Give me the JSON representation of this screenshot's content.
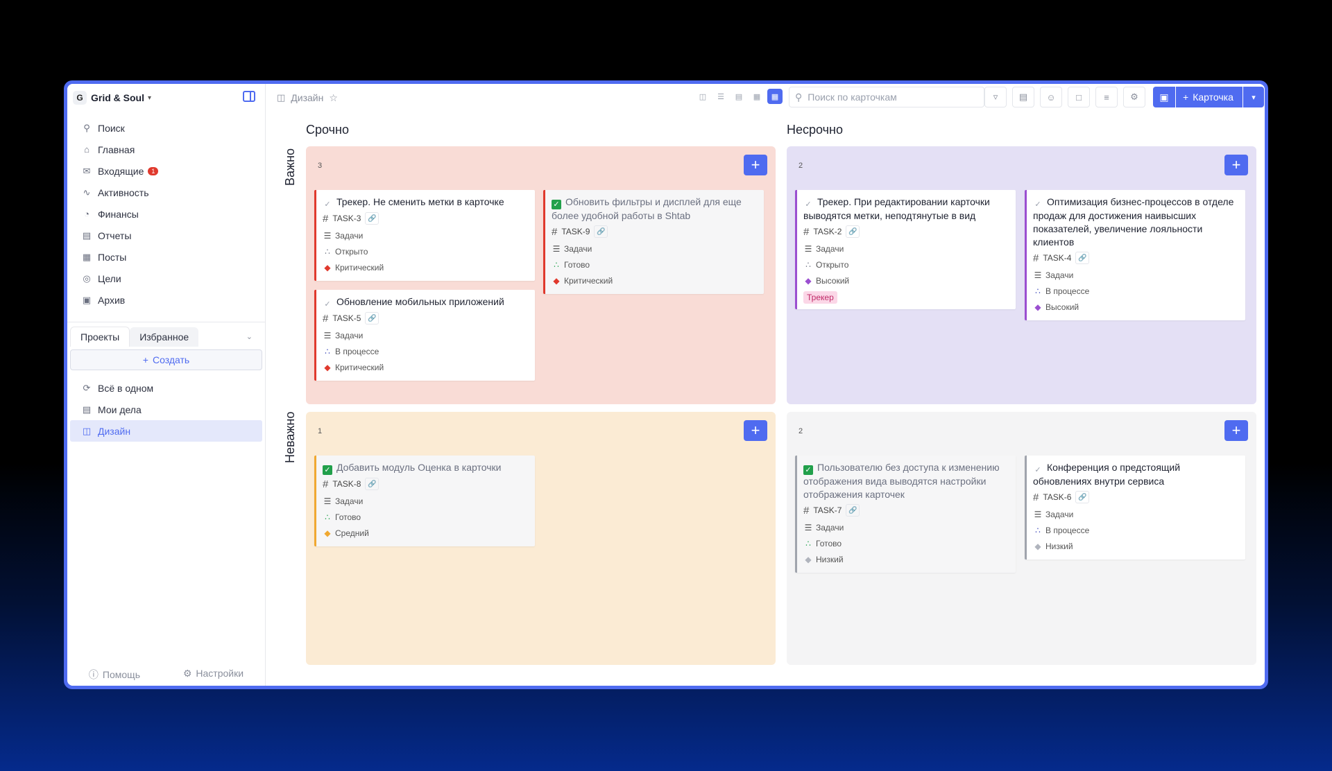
{
  "workspace": {
    "initial": "G",
    "name": "Grid & Soul"
  },
  "nav": [
    {
      "label": "Поиск",
      "icon": "search-icon"
    },
    {
      "label": "Главная",
      "icon": "home-icon"
    },
    {
      "label": "Входящие",
      "icon": "inbox-icon",
      "badge": "1"
    },
    {
      "label": "Активность",
      "icon": "activity-icon"
    },
    {
      "label": "Финансы",
      "icon": "finance-icon"
    },
    {
      "label": "Отчеты",
      "icon": "report-icon"
    },
    {
      "label": "Посты",
      "icon": "posts-icon"
    },
    {
      "label": "Цели",
      "icon": "goals-icon"
    },
    {
      "label": "Архив",
      "icon": "archive-icon"
    }
  ],
  "tabs": {
    "projects": "Проекты",
    "favorites": "Избранное"
  },
  "create_label": "Создать",
  "projects": [
    {
      "label": "Всё в одном",
      "icon": "all-in-one-icon"
    },
    {
      "label": "Мои дела",
      "icon": "my-tasks-icon"
    },
    {
      "label": "Дизайн",
      "icon": "board-icon",
      "active": true
    }
  ],
  "footer": {
    "help": "Помощь",
    "settings": "Настройки"
  },
  "topbar": {
    "breadcrumb": "Дизайн",
    "search_placeholder": "Поиск по карточкам",
    "new_card": "Карточка"
  },
  "columns": {
    "urgent": "Срочно",
    "not_urgent": "Несрочно"
  },
  "rows": {
    "important": "Важно",
    "not_important": "Неважно"
  },
  "quadrants": {
    "q1": {
      "count": "3",
      "bg": "#f9dcd6"
    },
    "q2": {
      "count": "2",
      "bg": "#e4e0f5"
    },
    "q3": {
      "count": "1",
      "bg": "#fbebd4"
    },
    "q4": {
      "count": "2",
      "bg": "#f4f4f5"
    }
  },
  "cards": {
    "c1": {
      "title": "Трекер. Не сменить метки в карточке",
      "id": "TASK-3",
      "type": "Задачи",
      "status": "Открыто",
      "priority": "Критический",
      "accent": "#e0392d"
    },
    "c2": {
      "title": "Обновление мобильных приложений",
      "id": "TASK-5",
      "type": "Задачи",
      "status": "В процессе",
      "priority": "Критический",
      "accent": "#e0392d"
    },
    "c3": {
      "title": "Обновить фильтры и дисплей для еще более удобной работы в Shtab",
      "id": "TASK-9",
      "type": "Задачи",
      "status": "Готово",
      "priority": "Критический",
      "accent": "#e0392d"
    },
    "c4": {
      "title": "Трекер. При редактировании карточки выводятся метки, неподтянутые в вид",
      "id": "TASK-2",
      "type": "Задачи",
      "status": "Открыто",
      "priority": "Высокий",
      "tag": "Трекер",
      "accent": "#9b4fd0"
    },
    "c5": {
      "title": "Оптимизация бизнес-процессов в отделе продаж для достижения наивысших показателей, увеличение лояльности клиентов",
      "id": "TASK-4",
      "type": "Задачи",
      "status": "В процессе",
      "priority": "Высокий",
      "accent": "#9b4fd0"
    },
    "c6": {
      "title": "Добавить модуль Оценка в карточки",
      "id": "TASK-8",
      "type": "Задачи",
      "status": "Готово",
      "priority": "Средний",
      "accent": "#f0a830"
    },
    "c7": {
      "title": "Пользователю без доступа к изменению отображения вида выводятся настройки отображения карточек",
      "id": "TASK-7",
      "type": "Задачи",
      "status": "Готово",
      "priority": "Низкий",
      "accent": "#a0a4ad"
    },
    "c8": {
      "title": "Конференция о предстоящий обновлениях внутри сервиса",
      "id": "TASK-6",
      "type": "Задачи",
      "status": "В процессе",
      "priority": "Низкий",
      "accent": "#a0a4ad"
    }
  },
  "colors": {
    "accent": "#4f6bf0",
    "status_open": "#6b7080",
    "status_progress": "#3a45b8",
    "status_done": "#22a04b",
    "priority_critical": "#e0392d",
    "priority_high": "#9b4fd0",
    "priority_medium": "#f0a830",
    "priority_low": "#b0b4bd"
  }
}
